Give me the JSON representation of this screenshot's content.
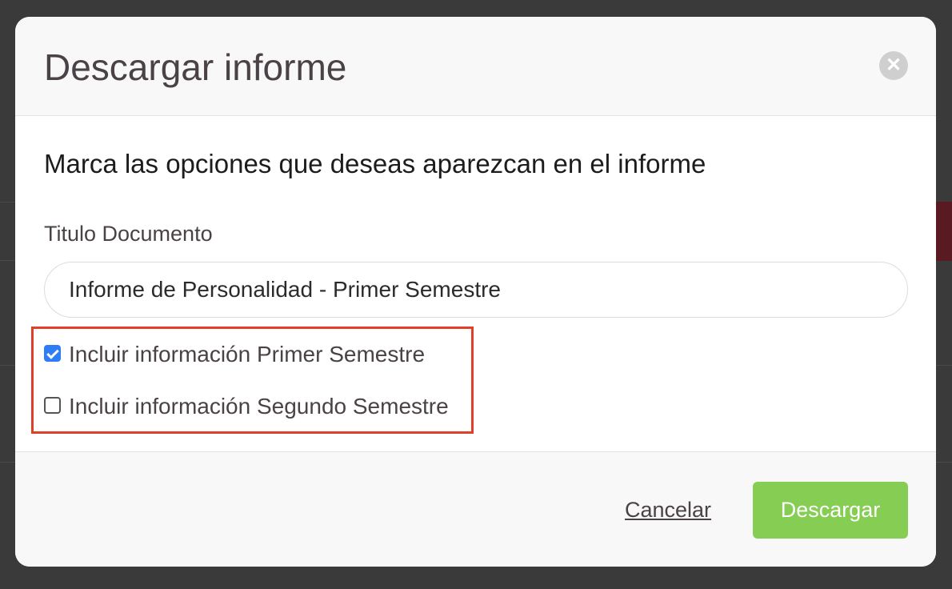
{
  "modal": {
    "title": "Descargar informe",
    "close_icon": "close-icon",
    "close_glyph": "✕"
  },
  "body": {
    "instructions": "Marca las opciones que deseas aparezcan en el informe",
    "title_field": {
      "label": "Titulo Documento",
      "value": "Informe de Personalidad - Primer Semestre"
    },
    "options": [
      {
        "label": "Incluir información Primer Semestre",
        "checked": true
      },
      {
        "label": "Incluir información Segundo Semestre",
        "checked": false
      }
    ]
  },
  "footer": {
    "cancel_label": "Cancelar",
    "download_label": "Descargar"
  },
  "colors": {
    "download_button": "#86cd53",
    "highlight_border": "#e0402a",
    "checkbox_checked": "#2f7df6"
  }
}
